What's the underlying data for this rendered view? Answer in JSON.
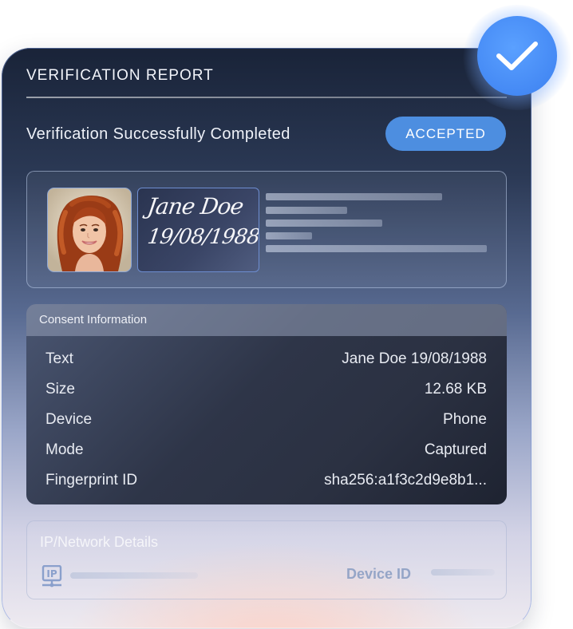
{
  "report": {
    "title": "VERIFICATION REPORT",
    "status_text": "Verification Successfully Completed",
    "badge": "ACCEPTED"
  },
  "id_card": {
    "signature_name": "Jane Doe",
    "signature_date": "19/08/1988"
  },
  "consent": {
    "title": "Consent Information",
    "rows": [
      {
        "label": "Text",
        "value": "Jane Doe 19/08/1988"
      },
      {
        "label": "Size",
        "value": "12.68 KB"
      },
      {
        "label": "Device",
        "value": "Phone"
      },
      {
        "label": "Mode",
        "value": "Captured"
      },
      {
        "label": "Fingerprint ID",
        "value": "sha256:a1f3c2d9e8b1..."
      }
    ]
  },
  "network": {
    "title": "IP/Network Details",
    "ip_icon_text": "IP",
    "device_label": "Device ID"
  },
  "colors": {
    "accent": "#4d8ee0",
    "check_badge": "#4a90f5"
  },
  "icons": {
    "check": "check-icon",
    "ip": "ip-network-icon"
  }
}
